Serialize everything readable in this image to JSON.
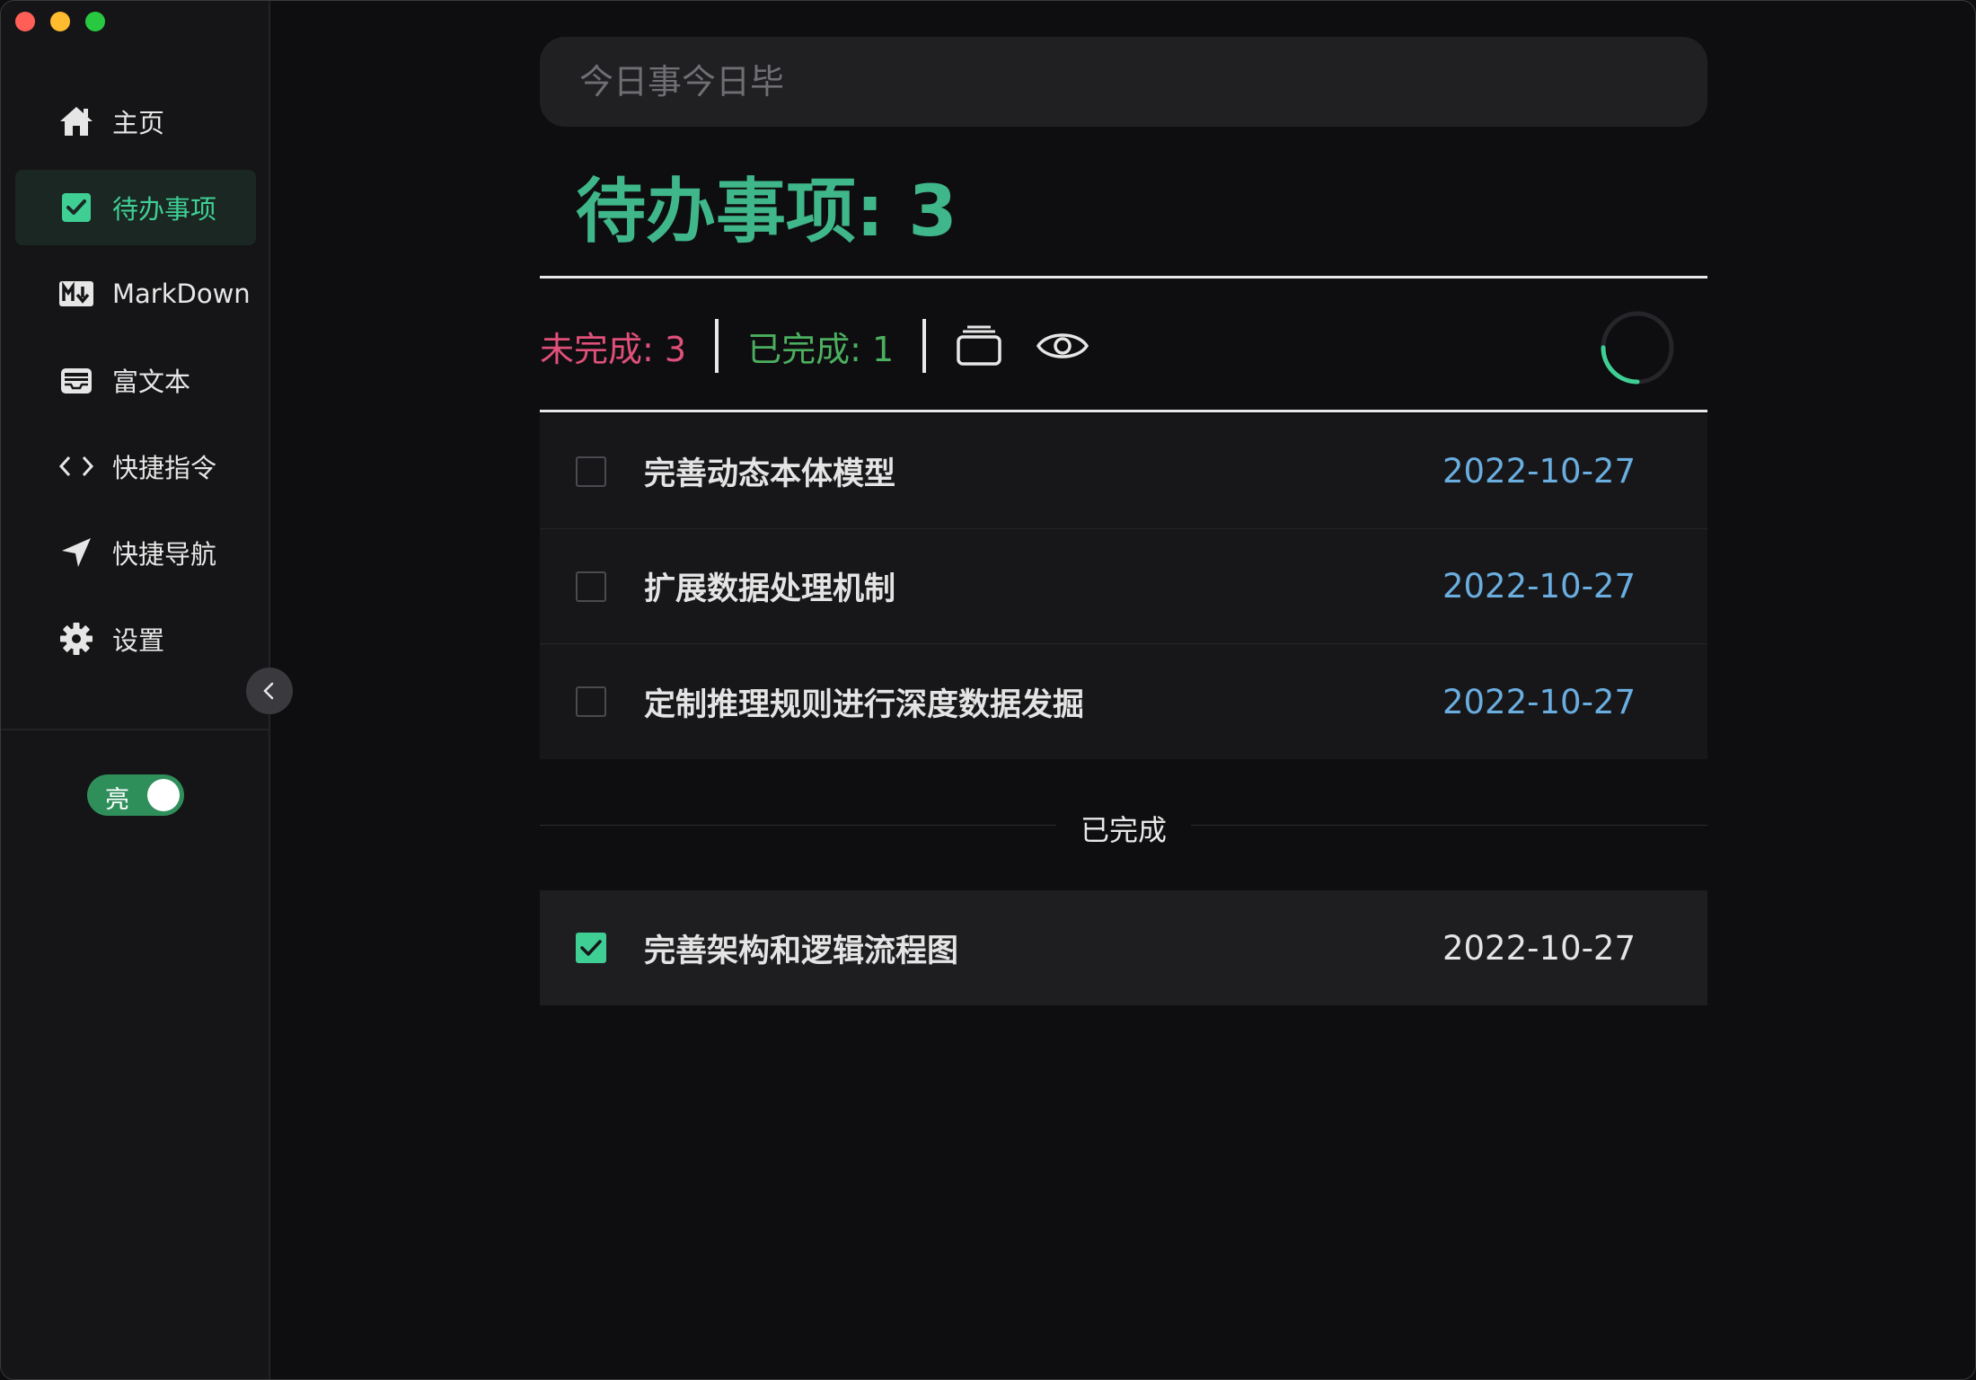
{
  "colors": {
    "accent": "#3fcf95",
    "title": "#3fb78a",
    "pending": "#e0507a",
    "done": "#4caf5f",
    "date": "#6aaee0"
  },
  "window_controls": [
    "close",
    "minimize",
    "maximize"
  ],
  "sidebar": {
    "items": [
      {
        "label": "主页",
        "icon": "home-icon",
        "active": false
      },
      {
        "label": "待办事项",
        "icon": "checkbox-icon",
        "active": true
      },
      {
        "label": "MarkDown",
        "icon": "markdown-icon",
        "active": false
      },
      {
        "label": "富文本",
        "icon": "inbox-icon",
        "active": false
      },
      {
        "label": "快捷指令",
        "icon": "code-icon",
        "active": false
      },
      {
        "label": "快捷导航",
        "icon": "navigation-arrow-icon",
        "active": false
      },
      {
        "label": "设置",
        "icon": "gear-icon",
        "active": false
      }
    ],
    "collapse_icon": "chevron-left-icon",
    "theme_toggle": {
      "label": "亮",
      "on": true
    }
  },
  "search": {
    "placeholder": "今日事今日毕",
    "value": ""
  },
  "header": {
    "title": "待办事项: 3"
  },
  "stats": {
    "pending_label": "未完成: 3",
    "done_label": "已完成: 1",
    "tools": [
      "stack-icon",
      "eye-icon"
    ],
    "progress": 0.25
  },
  "pending_todos": [
    {
      "title": "完善动态本体模型",
      "date": "2022-10-27",
      "checked": false
    },
    {
      "title": "扩展数据处理机制",
      "date": "2022-10-27",
      "checked": false
    },
    {
      "title": "定制推理规则进行深度数据发掘",
      "date": "2022-10-27",
      "checked": false
    }
  ],
  "done_section": {
    "label": "已完成"
  },
  "done_todos": [
    {
      "title": "完善架构和逻辑流程图",
      "date": "2022-10-27",
      "checked": true
    }
  ]
}
